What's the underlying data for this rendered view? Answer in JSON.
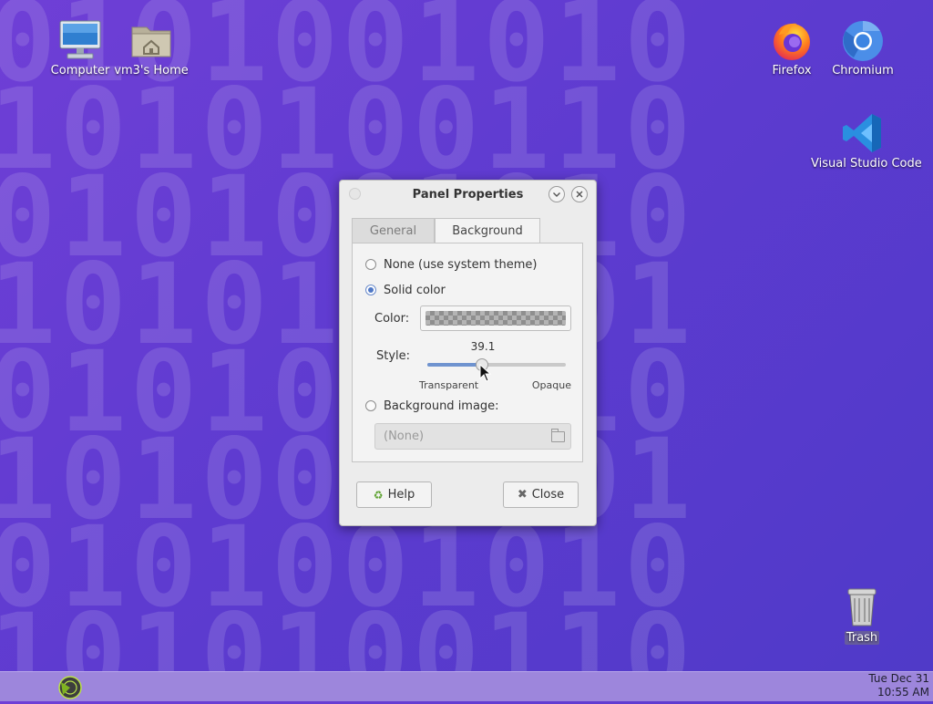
{
  "desktop": {
    "icons": [
      {
        "label": "Computer",
        "icon": "computer-icon"
      },
      {
        "label": "vm3's Home",
        "icon": "home-folder-icon"
      },
      {
        "label": "Firefox",
        "icon": "firefox-icon"
      },
      {
        "label": "Chromium",
        "icon": "chromium-icon"
      },
      {
        "label": "Visual Studio Code",
        "icon": "vscode-icon"
      },
      {
        "label": "Trash",
        "icon": "trash-icon"
      }
    ],
    "wallpaper_rows": [
      "0101001010",
      "1010100110",
      "0101001010",
      "1010100101",
      "0101001010",
      "1010010101",
      "0101001010",
      "1010100110"
    ]
  },
  "dialog": {
    "title": "Panel Properties",
    "tabs": [
      {
        "label": "General",
        "active": false
      },
      {
        "label": "Background",
        "active": true
      }
    ],
    "background": {
      "none_label": "None (use system theme)",
      "solid_label": "Solid color",
      "selected": "solid",
      "color_label": "Color:",
      "style_label": "Style:",
      "style_value": "39.1",
      "style_fraction": 0.391,
      "transparent_label": "Transparent",
      "opaque_label": "Opaque",
      "image_label": "Background image:",
      "image_file": "(None)"
    },
    "help_label": "Help",
    "close_label": "Close"
  },
  "taskbar": {
    "clock_date": "Tue Dec 31",
    "clock_time": "10:55 AM"
  },
  "colors": {
    "accent": "#4f78c6",
    "taskbar": "#9d86dc",
    "wallpaper": "#5e3bd0"
  }
}
